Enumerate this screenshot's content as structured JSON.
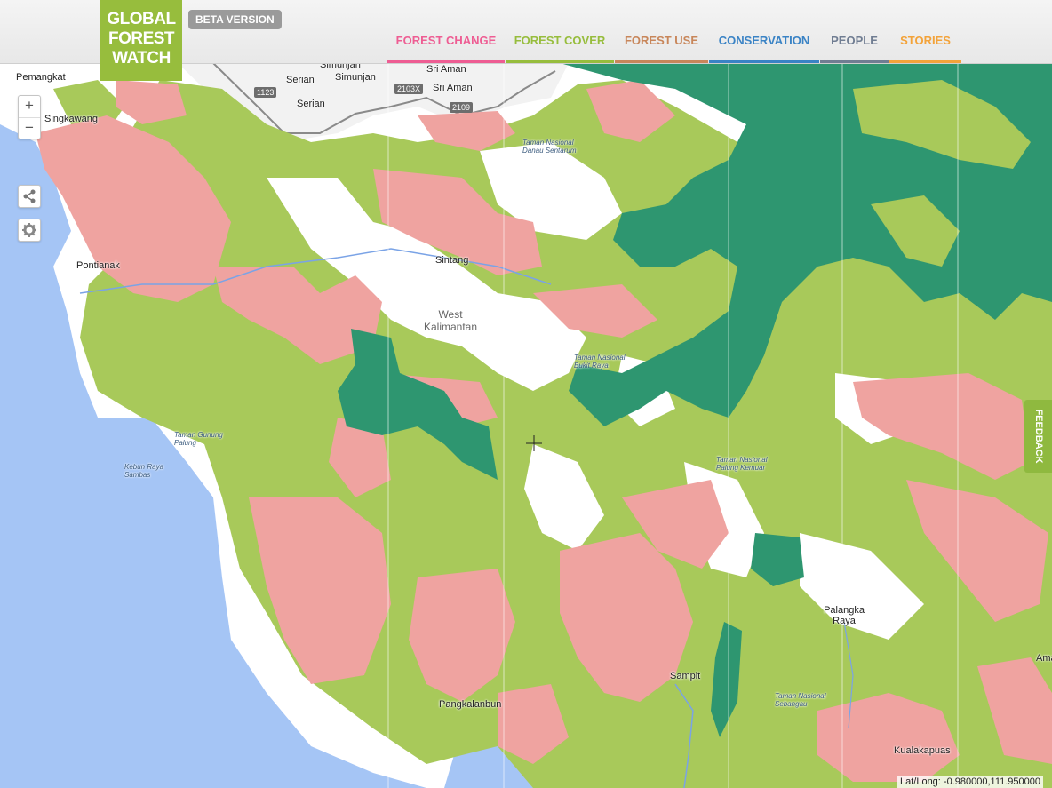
{
  "header": {
    "logo_lines": [
      "GLOBAL",
      "FOREST",
      "WATCH"
    ],
    "beta": "BETA VERSION",
    "nav": [
      {
        "label": "FOREST CHANGE",
        "color": "#ee5d93"
      },
      {
        "label": "FOREST COVER",
        "color": "#97bd3d"
      },
      {
        "label": "FOREST USE",
        "color": "#c8865a"
      },
      {
        "label": "CONSERVATION",
        "color": "#3a83c5"
      },
      {
        "label": "PEOPLE",
        "color": "#707d92"
      },
      {
        "label": "STORIES",
        "color": "#f3a33a"
      }
    ]
  },
  "map_controls": {
    "zoom_in": "+",
    "zoom_out": "−",
    "share_icon": "share-icon",
    "settings_icon": "gear-icon"
  },
  "feedback": "FEEDBACK",
  "coords": "Lat/Long: -0.980000,111.950000",
  "colors": {
    "primary_forest": "#2e9670",
    "tree_cover": "#a8c95a",
    "concession": "#efa3a0",
    "water": "#a5c5f5"
  },
  "places": {
    "pemangkat": "Pemangkat",
    "singkawang": "Singkawang",
    "pontianak": "Pontianak",
    "serian": "Serian",
    "simunjan_a": "Simunjan",
    "simunjan_b": "Simunjan",
    "sri_aman_a": "Sri Aman",
    "sri_aman_b": "Sri Aman",
    "sintang": "Sintang",
    "west_kalimantan": "West Kalimantan",
    "sampit": "Sampit",
    "palangka_raya": "Palangka Raya",
    "pangkalanbun": "Pangkalanbun",
    "kualakapuas": "Kualakapuas",
    "ama": "Ama",
    "tn_danau": "Taman Nasional Danau Sentarum",
    "tn_bukit": "Taman Nasional Bukit Raya",
    "tn_palung": "Taman Nasional Palung Kemuar",
    "tn_sebangau": "Taman Nasional Sebangau",
    "kebun_raya": "Kebun Raya Sambas",
    "taman_gunung": "Taman Gunung Palung"
  },
  "roads": [
    "1123",
    "2103X",
    "2109"
  ]
}
